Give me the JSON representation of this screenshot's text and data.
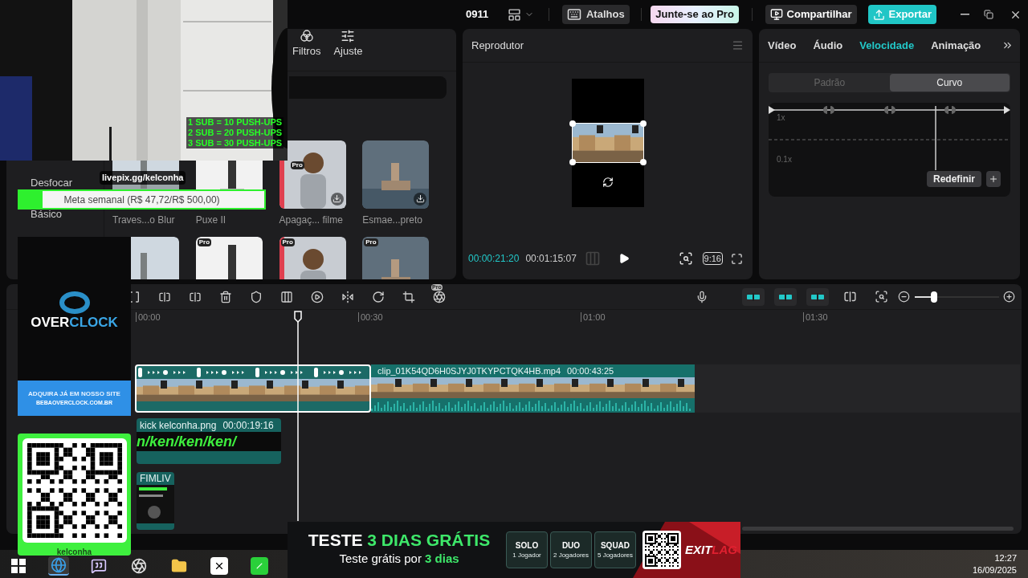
{
  "top_bar": {
    "project": "0911",
    "shortcuts": "Atalhos",
    "pro": "Junte-se ao Pro",
    "share": "Compartilhar",
    "export": "Exportar"
  },
  "media_panel": {
    "tabs": [
      {
        "label": "Filtros",
        "selected": false
      },
      {
        "label": "Ajuste",
        "selected": false
      }
    ],
    "categories": [
      {
        "label": "Desfocar",
        "selected": false
      },
      {
        "label": "Básico",
        "selected": false
      }
    ],
    "items": [
      {
        "label": "Traves...o Blur",
        "download": false
      },
      {
        "label": "Puxe II",
        "download": false
      },
      {
        "label": "Apagaç... filme",
        "badge": "Pro",
        "download": true
      },
      {
        "label": "Esmae...preto",
        "download": true
      },
      {
        "download": false
      },
      {
        "badge": "Pro",
        "download": false
      },
      {
        "badge": "Pro",
        "download": false
      },
      {
        "badge": "Pro",
        "download": false
      }
    ]
  },
  "player": {
    "title": "Reprodutor",
    "current": "00:00:21:20",
    "total": "00:01:15:07",
    "ratio": "9:16"
  },
  "inspector": {
    "tabs": [
      {
        "label": "Vídeo",
        "selected": false
      },
      {
        "label": "Áudio",
        "selected": false
      },
      {
        "label": "Velocidade",
        "selected": true
      },
      {
        "label": "Animação",
        "selected": false
      }
    ],
    "modes": [
      {
        "label": "Padrão",
        "selected": false
      },
      {
        "label": "Curvo",
        "selected": true
      }
    ],
    "curve_labels": [
      "1x",
      "0.1x"
    ],
    "reset": "Redefinir"
  },
  "timeline": {
    "toolbar_pro": "Pro",
    "snap_tools": [
      {
        "on": true
      },
      {
        "on": true
      },
      {
        "on": true
      }
    ],
    "zoom": {
      "level": 0.23
    },
    "ruler": [
      "00:00",
      "00:30",
      "01:00",
      "01:30"
    ],
    "main_clips": [
      {
        "selected": true,
        "speed_curve": true
      },
      {
        "selected": false,
        "name": "clip_01K54QD6H0SJYJ0TKYPCTQK4HB.mp4",
        "duration": "00:00:43:25"
      }
    ],
    "overlay_clip": {
      "name": "kick kelconha.png",
      "duration": "00:00:19:16",
      "content": "n/ken/ken/ken/"
    },
    "end_clip": {
      "name": "FIMLIV"
    }
  },
  "taskbar": {
    "apps": [
      {
        "kind": "start",
        "selected": false
      },
      {
        "kind": "browser",
        "selected": true
      },
      {
        "kind": "chat",
        "selected": false
      },
      {
        "kind": "obs",
        "selected": false
      },
      {
        "kind": "files",
        "selected": false
      },
      {
        "kind": "editor",
        "selected": false
      },
      {
        "kind": "green",
        "selected": false
      }
    ],
    "time": "12:27",
    "date": "16/09/2025"
  },
  "overlays": {
    "webcam": {
      "kind": "picture",
      "goals": [
        "1 SUB = 10 PUSH-UPS",
        "2 SUB = 20 PUSH-UPS",
        "3 SUB = 30 PUSH-UPS"
      ]
    },
    "donation": {
      "link": "livepix.gg/kelconha",
      "goal": "Meta semanal (R$ 47,72/R$ 500,00)",
      "level": 0.095
    },
    "sponsor": {
      "brand_a": "OVER",
      "brand_b": "CLOCK",
      "tagline": "ADQUIRA JÁ EM NOSSO SITE",
      "site": "BEBAOVERCLOCK.COM.BR"
    },
    "qr_card": {
      "handle": "kelconha"
    },
    "banner": {
      "headline_a": "TESTE",
      "headline_b": "3 DIAS GRÁTIS",
      "sub_a": "Teste grátis por",
      "sub_b": "3 dias",
      "plans": [
        {
          "name": "SOLO",
          "players": "1 Jogador"
        },
        {
          "name": "DUO",
          "players": "2 Jogadores"
        },
        {
          "name": "SQUAD",
          "players": "5 Jogadores"
        }
      ],
      "brand_a": "EXIT",
      "brand_b": "LAG"
    }
  }
}
